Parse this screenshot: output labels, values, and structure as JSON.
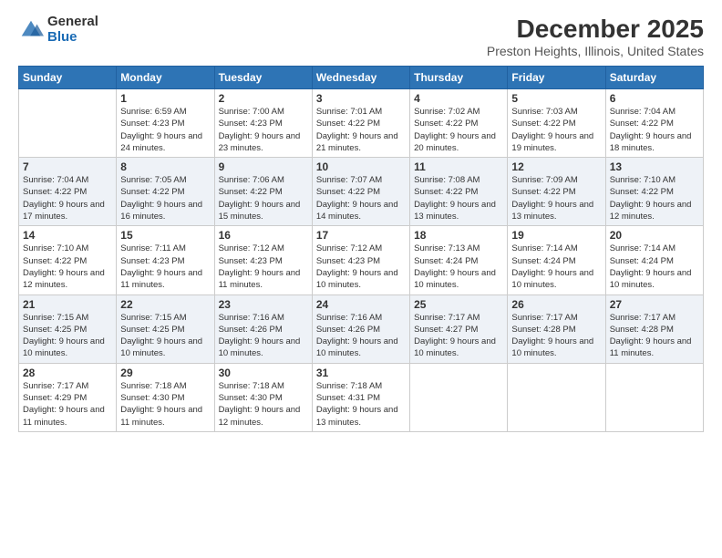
{
  "logo": {
    "general": "General",
    "blue": "Blue"
  },
  "title": "December 2025",
  "location": "Preston Heights, Illinois, United States",
  "weekdays": [
    "Sunday",
    "Monday",
    "Tuesday",
    "Wednesday",
    "Thursday",
    "Friday",
    "Saturday"
  ],
  "weeks": [
    [
      {
        "day": "",
        "sunrise": "",
        "sunset": "",
        "daylight": ""
      },
      {
        "day": "1",
        "sunrise": "6:59 AM",
        "sunset": "4:23 PM",
        "daylight": "9 hours and 24 minutes."
      },
      {
        "day": "2",
        "sunrise": "7:00 AM",
        "sunset": "4:23 PM",
        "daylight": "9 hours and 23 minutes."
      },
      {
        "day": "3",
        "sunrise": "7:01 AM",
        "sunset": "4:22 PM",
        "daylight": "9 hours and 21 minutes."
      },
      {
        "day": "4",
        "sunrise": "7:02 AM",
        "sunset": "4:22 PM",
        "daylight": "9 hours and 20 minutes."
      },
      {
        "day": "5",
        "sunrise": "7:03 AM",
        "sunset": "4:22 PM",
        "daylight": "9 hours and 19 minutes."
      },
      {
        "day": "6",
        "sunrise": "7:04 AM",
        "sunset": "4:22 PM",
        "daylight": "9 hours and 18 minutes."
      }
    ],
    [
      {
        "day": "7",
        "sunrise": "7:04 AM",
        "sunset": "4:22 PM",
        "daylight": "9 hours and 17 minutes."
      },
      {
        "day": "8",
        "sunrise": "7:05 AM",
        "sunset": "4:22 PM",
        "daylight": "9 hours and 16 minutes."
      },
      {
        "day": "9",
        "sunrise": "7:06 AM",
        "sunset": "4:22 PM",
        "daylight": "9 hours and 15 minutes."
      },
      {
        "day": "10",
        "sunrise": "7:07 AM",
        "sunset": "4:22 PM",
        "daylight": "9 hours and 14 minutes."
      },
      {
        "day": "11",
        "sunrise": "7:08 AM",
        "sunset": "4:22 PM",
        "daylight": "9 hours and 13 minutes."
      },
      {
        "day": "12",
        "sunrise": "7:09 AM",
        "sunset": "4:22 PM",
        "daylight": "9 hours and 13 minutes."
      },
      {
        "day": "13",
        "sunrise": "7:10 AM",
        "sunset": "4:22 PM",
        "daylight": "9 hours and 12 minutes."
      }
    ],
    [
      {
        "day": "14",
        "sunrise": "7:10 AM",
        "sunset": "4:22 PM",
        "daylight": "9 hours and 12 minutes."
      },
      {
        "day": "15",
        "sunrise": "7:11 AM",
        "sunset": "4:23 PM",
        "daylight": "9 hours and 11 minutes."
      },
      {
        "day": "16",
        "sunrise": "7:12 AM",
        "sunset": "4:23 PM",
        "daylight": "9 hours and 11 minutes."
      },
      {
        "day": "17",
        "sunrise": "7:12 AM",
        "sunset": "4:23 PM",
        "daylight": "9 hours and 10 minutes."
      },
      {
        "day": "18",
        "sunrise": "7:13 AM",
        "sunset": "4:24 PM",
        "daylight": "9 hours and 10 minutes."
      },
      {
        "day": "19",
        "sunrise": "7:14 AM",
        "sunset": "4:24 PM",
        "daylight": "9 hours and 10 minutes."
      },
      {
        "day": "20",
        "sunrise": "7:14 AM",
        "sunset": "4:24 PM",
        "daylight": "9 hours and 10 minutes."
      }
    ],
    [
      {
        "day": "21",
        "sunrise": "7:15 AM",
        "sunset": "4:25 PM",
        "daylight": "9 hours and 10 minutes."
      },
      {
        "day": "22",
        "sunrise": "7:15 AM",
        "sunset": "4:25 PM",
        "daylight": "9 hours and 10 minutes."
      },
      {
        "day": "23",
        "sunrise": "7:16 AM",
        "sunset": "4:26 PM",
        "daylight": "9 hours and 10 minutes."
      },
      {
        "day": "24",
        "sunrise": "7:16 AM",
        "sunset": "4:26 PM",
        "daylight": "9 hours and 10 minutes."
      },
      {
        "day": "25",
        "sunrise": "7:17 AM",
        "sunset": "4:27 PM",
        "daylight": "9 hours and 10 minutes."
      },
      {
        "day": "26",
        "sunrise": "7:17 AM",
        "sunset": "4:28 PM",
        "daylight": "9 hours and 10 minutes."
      },
      {
        "day": "27",
        "sunrise": "7:17 AM",
        "sunset": "4:28 PM",
        "daylight": "9 hours and 11 minutes."
      }
    ],
    [
      {
        "day": "28",
        "sunrise": "7:17 AM",
        "sunset": "4:29 PM",
        "daylight": "9 hours and 11 minutes."
      },
      {
        "day": "29",
        "sunrise": "7:18 AM",
        "sunset": "4:30 PM",
        "daylight": "9 hours and 11 minutes."
      },
      {
        "day": "30",
        "sunrise": "7:18 AM",
        "sunset": "4:30 PM",
        "daylight": "9 hours and 12 minutes."
      },
      {
        "day": "31",
        "sunrise": "7:18 AM",
        "sunset": "4:31 PM",
        "daylight": "9 hours and 13 minutes."
      },
      {
        "day": "",
        "sunrise": "",
        "sunset": "",
        "daylight": ""
      },
      {
        "day": "",
        "sunrise": "",
        "sunset": "",
        "daylight": ""
      },
      {
        "day": "",
        "sunrise": "",
        "sunset": "",
        "daylight": ""
      }
    ]
  ]
}
